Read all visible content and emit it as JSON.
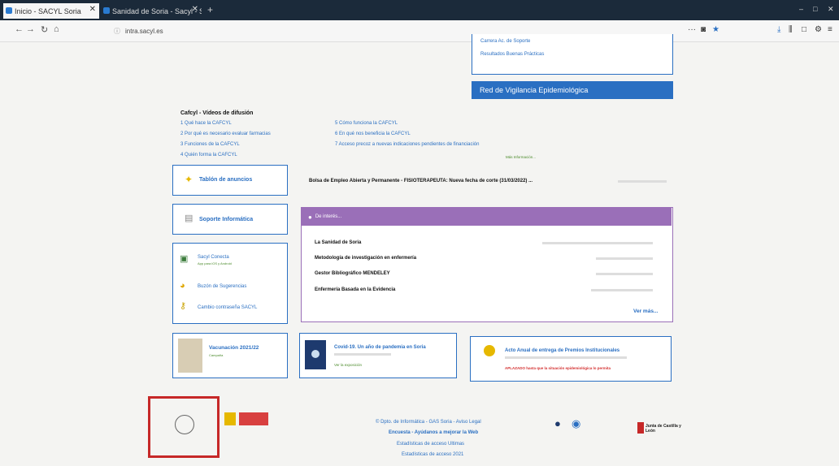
{
  "browser": {
    "tabs": [
      {
        "label": "Inicio - SACYL Soria"
      },
      {
        "label": "Sanidad de Soria - Sacyl - Soria"
      }
    ],
    "url": "intra.sacyl.es",
    "window_controls": [
      "–",
      "□",
      "✕"
    ]
  },
  "top": {
    "box_link_a": "Carrera Ac. de Soporte",
    "box_link_b": "Resultados Buenas Prácticas",
    "red_vigilancia": "Red de Vigilancia Epidemiológica"
  },
  "cafcyl": {
    "title": "Cafcyl - Vídeos de difusión",
    "left": [
      "1 Qué hace la CAFCYL",
      "2 Por qué es necesario evaluar farmacias",
      "3 Funciones de la CAFCYL",
      "4 Quién forma la CAFCYL"
    ],
    "right": [
      "5 Cómo funciona la CAFCYL",
      "6 En qué nos beneficia la CAFCYL",
      "7 Acceso precoz a nuevas indicaciones pendientes de financiación"
    ],
    "more": "Más Información..."
  },
  "tablon": {
    "label": "Tablón de anuncios"
  },
  "bolsa": {
    "text": "Bolsa de Empleo Abierta y Permanente - FISIOTERAPEUTA: Nueva fecha de corte (31/03/2022) ..."
  },
  "soporte": {
    "label": "Soporte Informática"
  },
  "interes": {
    "header": "De interés...",
    "items": [
      "La Sanidad de Soria",
      "Metodología de investigación en enfermería",
      "Gestor Bibliográfico MENDELEY",
      "Enfermería Basada en la Evidencia"
    ],
    "more": "Ver más..."
  },
  "links": {
    "sacyl_conecta": "Sacyl Conecta",
    "sacyl_conecta_sub": "App para iOS y Android",
    "buzon": "Buzón de Sugerencias",
    "cambio": "Cambio contraseña SACYL"
  },
  "vacunacion": {
    "title": "Vacunación 2021/22",
    "sub": "Campaña"
  },
  "covid": {
    "title": "Covid-19. Un año de pandemia en Soria",
    "sub": "Ver la exposición"
  },
  "acto": {
    "title": "Acto Anual de entrega de Premios Institucionales",
    "notice": "APLAZADO hasta que la situación epidemiológica lo permita"
  },
  "footer": {
    "line1_prefix": "© Dpto. de Informática - GAS Soria - ",
    "aviso": "Aviso Legal",
    "encuesta": "Encuesta - Ayúdanos a mejorar la Web",
    "stats1": "Estadísticas de acceso Ultimas",
    "stats2": "Estadísticas de acceso 2021",
    "junta": "Junta de Castilla y León"
  },
  "colors": {
    "accent": "#2a6fc2",
    "purple": "#9a6fb8",
    "highlight": "#c62828",
    "alert": "#d32f2f"
  }
}
